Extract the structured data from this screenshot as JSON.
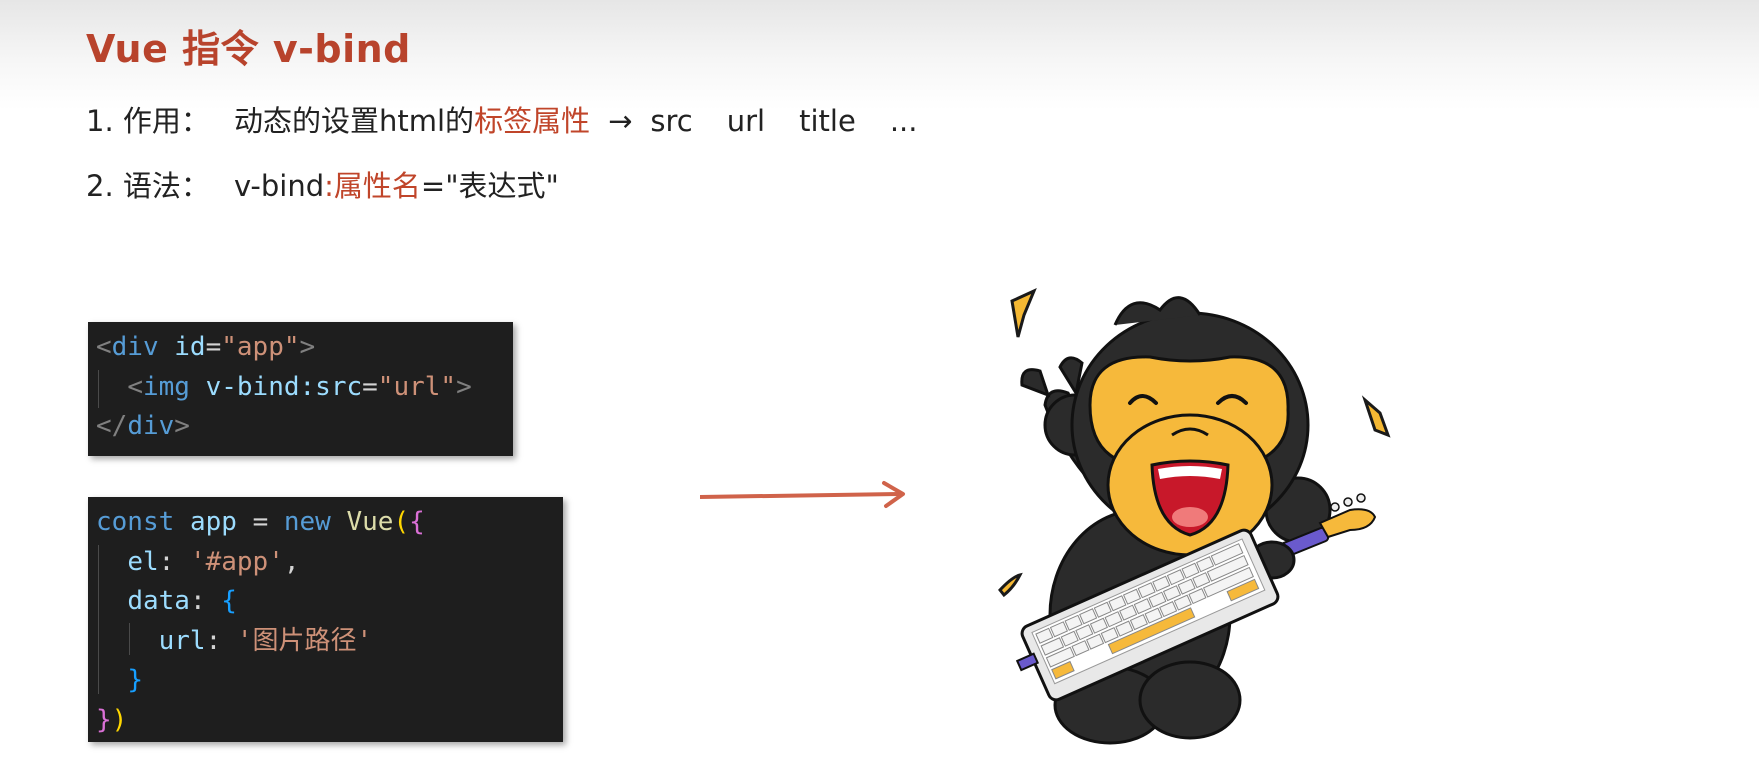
{
  "slide": {
    "title": "Vue 指令 v-bind",
    "item1": {
      "label": "1. 作用：",
      "text": "动态的设置html的",
      "highlight": "标签属性",
      "arrow": "→",
      "terms": [
        "src",
        "url",
        "title",
        "..."
      ]
    },
    "item2": {
      "label": "2. 语法：",
      "prefix": "v-bind",
      "highlight": ":属性名",
      "suffix": "=\"表达式\""
    }
  },
  "code_html": {
    "line1": {
      "lt": "<",
      "tag": "div",
      "attr": "id",
      "eq": "=",
      "val": "\"app\"",
      "gt": ">"
    },
    "line2": {
      "lt": "<",
      "tag": "img",
      "attr": "v-bind:src",
      "eq": "=",
      "val": "\"url\"",
      "gt": ">"
    },
    "line3": {
      "lt": "</",
      "tag": "div",
      "gt": ">"
    }
  },
  "code_js": {
    "line1": {
      "kw1": "const",
      "var": "app",
      "eq": "=",
      "kw2": "new",
      "cls": "Vue",
      "paren": "(",
      "brace": "{"
    },
    "line2": {
      "key": "el",
      "colon": ":",
      "str": "'#app'",
      "comma": ","
    },
    "line3": {
      "key": "data",
      "colon": ":",
      "brace": "{"
    },
    "line4": {
      "key": "url",
      "colon": ":",
      "str": "'图片路径'"
    },
    "line5": {
      "brace": "}"
    },
    "line6": {
      "brace": "}",
      "paren": ")"
    }
  },
  "colors": {
    "title": "#b8432c",
    "highlight": "#c0452a",
    "arrow": "#d0634a",
    "code_bg": "#1e1e1e"
  },
  "illustration": {
    "icon": "monkey-mascot-with-keyboard-guitar"
  }
}
